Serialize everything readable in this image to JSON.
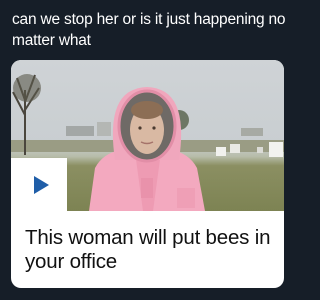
{
  "post": {
    "text": "can we stop her or is it just happening no matter what"
  },
  "card": {
    "headline": "This woman will put bees in your office",
    "play_icon": "play-icon"
  },
  "colors": {
    "background": "#161e28",
    "post_text": "#ffffff",
    "card_background": "#ffffff",
    "play_icon": "#1f5ea8",
    "headline_text": "#111111"
  }
}
